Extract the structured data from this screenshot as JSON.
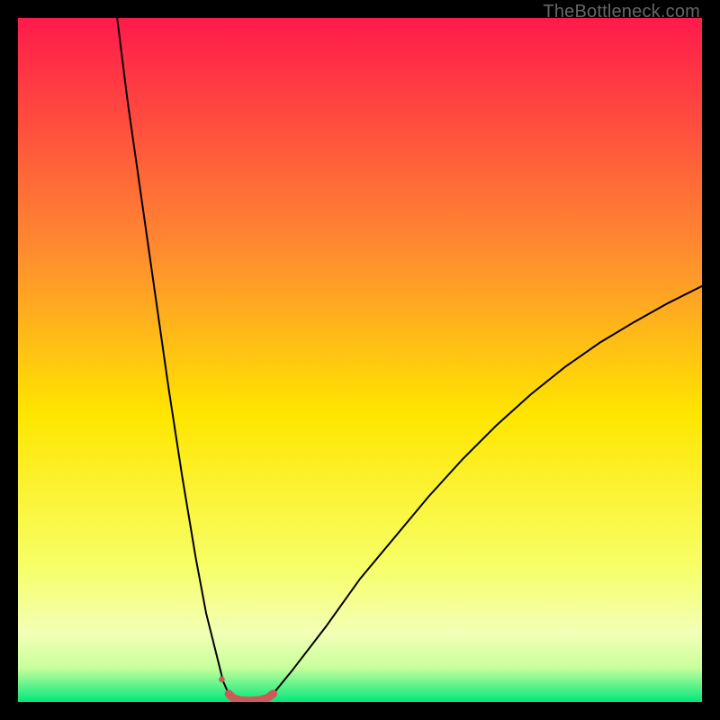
{
  "watermark": "TheBottleneck.com",
  "chart_data": {
    "type": "line",
    "title": "",
    "xlabel": "",
    "ylabel": "",
    "xlim": [
      0,
      100
    ],
    "ylim": [
      0,
      100
    ],
    "grid": false,
    "legend": false,
    "gradient_colors": {
      "top": "#ff1a4b",
      "mid_upper": "#ffa733",
      "mid": "#ffe600",
      "mid_lower": "#f9ff89",
      "near_bottom": "#e6ffa8",
      "bottom": "#00e77b"
    },
    "series": [
      {
        "name": "left-branch",
        "stroke": "#000000",
        "stroke_width": 2,
        "x": [
          14.5,
          16,
          18,
          20,
          22,
          24,
          26,
          27.5,
          29,
          30,
          30.8
        ],
        "y": [
          100,
          88,
          74,
          60,
          46,
          33,
          21,
          13,
          7,
          3,
          1.2
        ]
      },
      {
        "name": "right-branch",
        "stroke": "#000000",
        "stroke_width": 2,
        "x": [
          37.3,
          40,
          45,
          50,
          55,
          60,
          65,
          70,
          75,
          80,
          85,
          90,
          95,
          100
        ],
        "y": [
          1.2,
          4.5,
          11,
          18,
          24,
          30,
          35.5,
          40.5,
          45,
          49,
          52.5,
          55.5,
          58.3,
          60.8
        ]
      },
      {
        "name": "highlight-region",
        "stroke": "#cc5a56",
        "stroke_width": 9,
        "linecap": "round",
        "x": [
          30.8,
          31.5,
          32.5,
          34,
          35.5,
          36.5,
          37.3
        ],
        "y": [
          1.2,
          0.55,
          0.25,
          0.2,
          0.3,
          0.6,
          1.2
        ]
      }
    ],
    "annotations": [
      {
        "type": "dot",
        "x": 29.8,
        "y": 3.3,
        "r": 3.3,
        "fill": "#cc5a56"
      }
    ]
  }
}
